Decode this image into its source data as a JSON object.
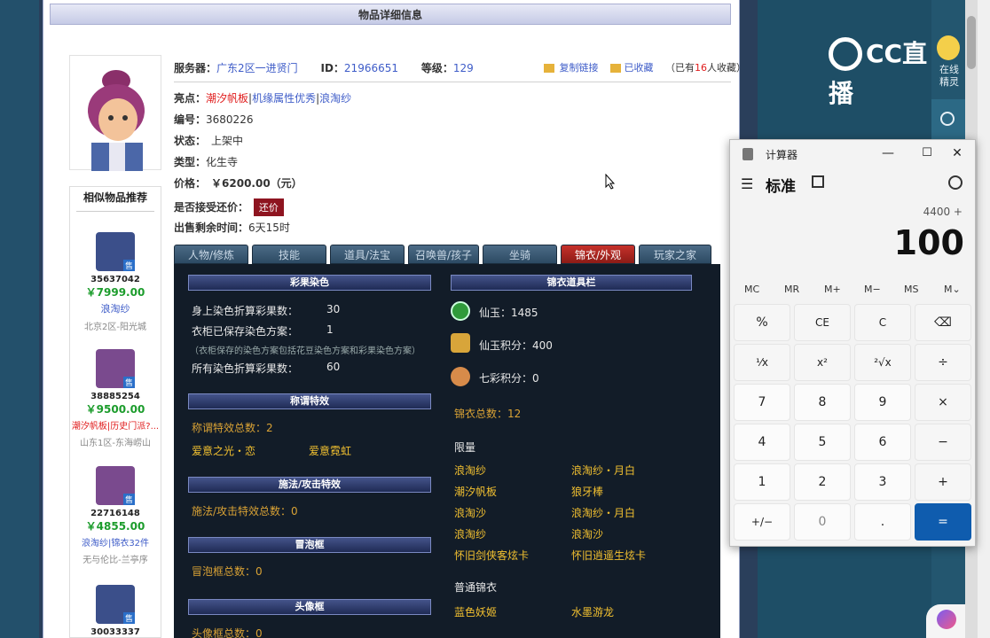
{
  "page_title": "物品详细信息",
  "info": {
    "server_label": "服务器：",
    "server_value": "广东2区一进贤门",
    "id_label": "ID：",
    "id_value": "21966651",
    "level_label": "等级：",
    "level_value": "129",
    "copy_link": "复制链接",
    "favorited": "已收藏",
    "fav_count_prefix": "（已有",
    "fav_count": "16",
    "fav_count_suffix": "人收藏）",
    "highlight_label": "亮点：",
    "highlight_1": "潮汐帆板",
    "highlight_sep": "|",
    "highlight_2": "机缘属性优秀",
    "highlight_3": "浪淘纱",
    "number_label": "编号：",
    "number_value": "3680226",
    "status_label": "状态：",
    "status_value": "上架中",
    "type_label": "类型：",
    "type_value": "化生寺",
    "price_label": "价格：",
    "price_value": "￥6200.00（元）",
    "bargain_label": "是否接受还价：",
    "bargain_button": "还价",
    "remaining_label": "出售剩余时间：",
    "remaining_value": "6天15时"
  },
  "similar": {
    "title": "相似物品推荐",
    "items": [
      {
        "id": "35637042",
        "price": "￥7999.00",
        "tag": "浪淘纱",
        "server": "北京2区-阳光城"
      },
      {
        "id": "38885254",
        "price": "￥9500.00",
        "tag": "潮汐帆板|历史门派?...",
        "server": "山东1区-东海崂山"
      },
      {
        "id": "22716148",
        "price": "￥4855.00",
        "tag": "浪淘纱|锦衣32件",
        "server": "无与伦比-兰亭序"
      },
      {
        "id": "30033337"
      }
    ],
    "sell_badge": "售"
  },
  "tabs": [
    "人物/修炼",
    "技能",
    "道具/法宝",
    "召唤兽/孩子",
    "坐骑",
    "锦衣/外观",
    "玩家之家"
  ],
  "left_panel": {
    "dye_title": "彩果染色",
    "dye_rows": [
      {
        "label": "身上染色折算彩果数：",
        "value": "30"
      },
      {
        "label": "衣柜已保存染色方案：",
        "value": "1"
      }
    ],
    "dye_note": "（衣柜保存的染色方案包括花豆染色方案和彩果染色方案）",
    "dye_total_label": "所有染色折算彩果数：",
    "dye_total_value": "60",
    "title_fx_head": "称谓特效",
    "title_fx_total": "称谓特效总数：2",
    "title_fx_1": "爱意之光・恋",
    "title_fx_2": "爱意霓虹",
    "cast_fx_head": "施法/攻击特效",
    "cast_fx_total": "施法/攻击特效总数：0",
    "bubble_head": "冒泡框",
    "bubble_total": "冒泡框总数：0",
    "avatar_frame_head": "头像框",
    "avatar_frame_total": "头像框总数：0"
  },
  "right_panel": {
    "head": "锦衣道具栏",
    "xianyu": "仙玉：1485",
    "xianyu_points": "仙玉积分：400",
    "qicai_points": "七彩积分：0",
    "total": "锦衣总数：12",
    "limited_label": "限量",
    "limited_items": [
      [
        "浪淘纱",
        "浪淘纱・月白"
      ],
      [
        "潮汐帆板",
        "狼牙棒"
      ],
      [
        "浪淘沙",
        "浪淘纱・月白"
      ],
      [
        "浪淘纱",
        "浪淘沙"
      ],
      [
        "怀旧剑侠客炫卡",
        "怀旧逍遥生炫卡"
      ]
    ],
    "normal_label": "普通锦衣",
    "normal_items": [
      [
        "蓝色妖姬",
        "水墨游龙"
      ]
    ]
  },
  "side_widget": {
    "online_elf": "在线精灵",
    "brand": "CC直播"
  },
  "calculator": {
    "app_name": "计算器",
    "mode": "标准",
    "expression": "4400 +",
    "display": "100",
    "memory": [
      "MC",
      "MR",
      "M+",
      "M−",
      "MS",
      "M⌄"
    ],
    "keys": [
      [
        "%",
        "CE",
        "C",
        "⌫"
      ],
      [
        "¹⁄x",
        "x²",
        "²√x",
        "÷"
      ],
      [
        "7",
        "8",
        "9",
        "×"
      ],
      [
        "4",
        "5",
        "6",
        "−"
      ],
      [
        "1",
        "2",
        "3",
        "+"
      ],
      [
        "+/−",
        "0",
        ".",
        "="
      ]
    ],
    "accent": "#0f5cae"
  }
}
